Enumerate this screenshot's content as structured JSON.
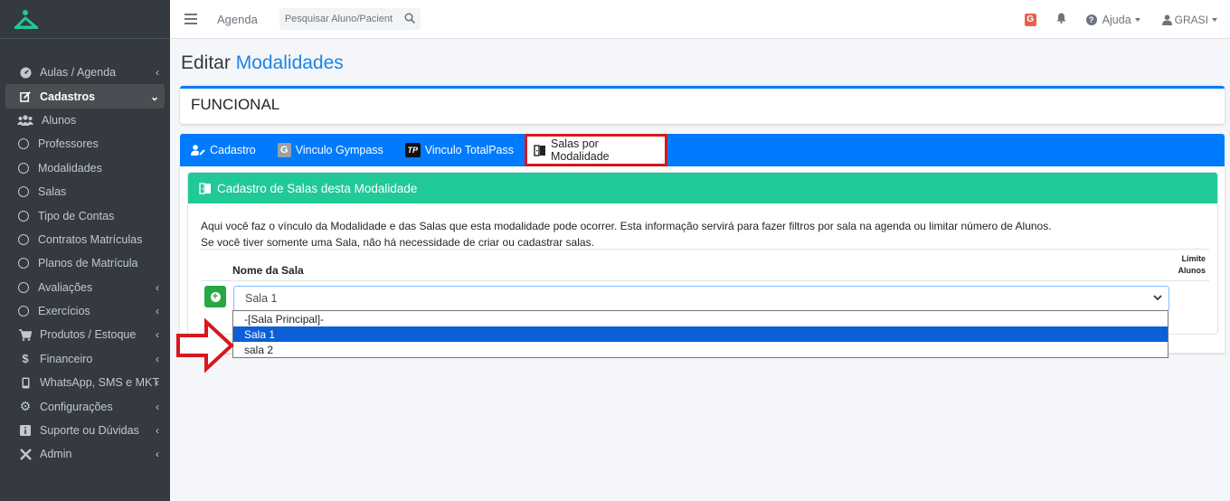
{
  "topbar": {
    "agenda_label": "Agenda",
    "search_placeholder": "Pesquisar Aluno/Pacient",
    "g_badge": "G",
    "help_label": "Ajuda",
    "user_label": "GRASI"
  },
  "sidebar": {
    "items": [
      {
        "label": "Aulas / Agenda",
        "icon": "dashboard-icon"
      },
      {
        "label": "Cadastros",
        "icon": "edit-icon"
      },
      {
        "label": "Alunos",
        "icon": "users-icon"
      },
      {
        "label": "Professores",
        "icon": "circle-icon"
      },
      {
        "label": "Modalidades",
        "icon": "circle-icon"
      },
      {
        "label": "Salas",
        "icon": "circle-icon"
      },
      {
        "label": "Tipo de Contas",
        "icon": "circle-icon"
      },
      {
        "label": "Contratos Matrículas",
        "icon": "circle-icon"
      },
      {
        "label": "Planos de Matrícula",
        "icon": "circle-icon"
      },
      {
        "label": "Avaliações",
        "icon": "circle-icon"
      },
      {
        "label": "Exercícios",
        "icon": "circle-icon"
      },
      {
        "label": "Produtos / Estoque",
        "icon": "cart-icon"
      },
      {
        "label": "Financeiro",
        "icon": "dollar-icon"
      },
      {
        "label": "WhatsApp, SMS e MKT",
        "icon": "mobile-icon"
      },
      {
        "label": "Configurações",
        "icon": "gear-icon"
      },
      {
        "label": "Suporte ou Dúvidas",
        "icon": "info-icon"
      },
      {
        "label": "Admin",
        "icon": "tools-icon"
      }
    ]
  },
  "page": {
    "title_prefix": "Editar",
    "title_highlight": "Modalidades",
    "record_name": "FUNCIONAL"
  },
  "tabs": [
    {
      "label": "Cadastro"
    },
    {
      "label": "Vinculo Gympass"
    },
    {
      "label": "Vinculo TotalPass"
    },
    {
      "label": "Salas por Modalidade"
    }
  ],
  "section": {
    "header": "Cadastro de Salas desta Modalidade",
    "desc_line1": "Aqui você faz o vínculo da Modalidade e das Salas que esta modalidade pode ocorrer. Esta informação servirá para fazer filtros por sala na agenda ou limitar número de Alunos.",
    "desc_line2": "Se você tiver somente uma Sala, não há necessidade de criar ou cadastrar salas.",
    "col_name": "Nome da Sala",
    "col_limit_1": "Limite",
    "col_limit_2": "Alunos",
    "selected_value": "Sala 1",
    "options": [
      "-[Sala Principal]-",
      "Sala 1",
      "sala 2"
    ]
  },
  "colors": {
    "sidebar_bg": "#343a40",
    "primary": "#007bff",
    "teal": "#20c997",
    "success": "#28a745",
    "highlight_red": "#d7171f",
    "option_selected": "#0c5fd6"
  }
}
